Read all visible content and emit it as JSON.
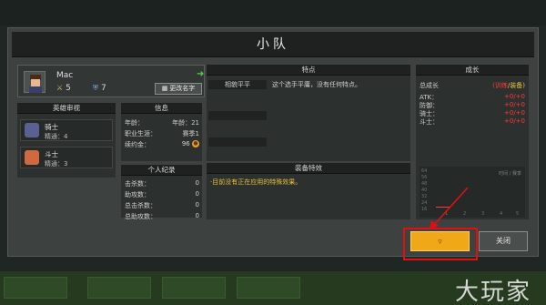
{
  "dialog": {
    "title": "小队",
    "confirm_label": "",
    "close_label": "关闭"
  },
  "character": {
    "name": "Mac",
    "attack": "5",
    "defense": "7",
    "rename_label": "更改名字"
  },
  "recruit": {
    "header": "英雄审视",
    "items": [
      {
        "name": "骑士",
        "level": "精通：4"
      },
      {
        "name": "斗士",
        "level": "精通：3"
      }
    ]
  },
  "info": {
    "header": "信息",
    "rows": [
      {
        "label": "年龄：",
        "value": "年龄：21"
      },
      {
        "label": "职业生涯：",
        "value": "赛季1"
      },
      {
        "label": "续约金：",
        "value": "96"
      }
    ]
  },
  "record": {
    "header": "个人纪录",
    "rows": [
      {
        "label": "击杀数：",
        "value": "0"
      },
      {
        "label": "助攻数：",
        "value": "0"
      },
      {
        "label": "总击杀数：",
        "value": "0"
      },
      {
        "label": "总助攻数：",
        "value": "0"
      }
    ]
  },
  "traits": {
    "header": "特点",
    "chip": "相貌平平",
    "desc": "这个选手平庸，没有任何特点。"
  },
  "equipment": {
    "header": "装备特效",
    "note": "·目前没有正在应用的特殊效果。"
  },
  "growth": {
    "header": "成长",
    "total_label": "总成长",
    "total_hint_a": "(训练",
    "total_hint_b": "/装备)",
    "rows": [
      {
        "label": "ATK：",
        "value": "+0/+0"
      },
      {
        "label": "防御：",
        "value": "+0/+0"
      },
      {
        "label": "骑士：",
        "value": "+0/+0"
      },
      {
        "label": "斗士：",
        "value": "+0/+0"
      }
    ],
    "chart_legend": "时间 / 赛季",
    "chart_yticks": [
      "64",
      "56",
      "48",
      "40",
      "32",
      "24",
      "16"
    ],
    "chart_xticks": [
      "1",
      "2",
      "3",
      "4",
      "5"
    ]
  },
  "background": {
    "watermark": "大玩家",
    "colors": {
      "accent": "#f0a818",
      "highlight": "#e01010",
      "positive": "#4fd050"
    }
  }
}
